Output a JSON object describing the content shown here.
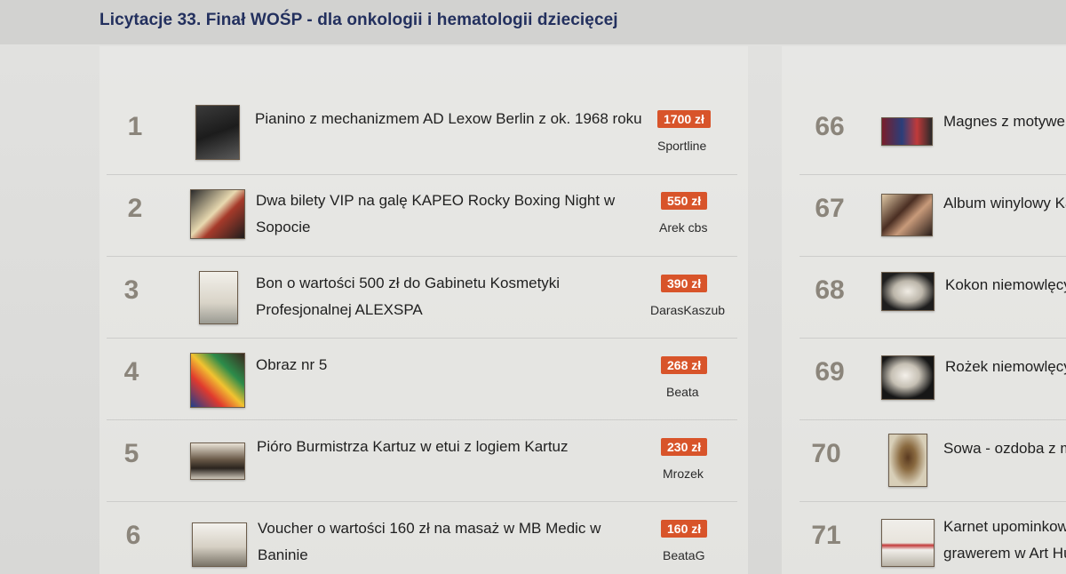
{
  "page_title": "Licytacje 33. Finał WOŚP - dla onkologii i hematologii dziecięcej",
  "left_items": [
    {
      "rank": "1",
      "title1": "Pianino z mechanizmem AD Lexow Berlin z ok. 1968 roku",
      "title2": "",
      "price": "1700 zł",
      "bidder": "Sportline"
    },
    {
      "rank": "2",
      "title1": "Dwa bilety VIP na galę KAPEO Rocky Boxing Night w",
      "title2": "Sopocie",
      "price": "550 zł",
      "bidder": "Arek cbs"
    },
    {
      "rank": "3",
      "title1": "Bon o wartości 500 zł do Gabinetu Kosmetyki",
      "title2": "Profesjonalnej ALEXSPA",
      "price": "390 zł",
      "bidder": "DarasKaszub"
    },
    {
      "rank": "4",
      "title1": "Obraz nr 5",
      "title2": "",
      "price": "268 zł",
      "bidder": "Beata"
    },
    {
      "rank": "5",
      "title1": "Pióro Burmistrza Kartuz w etui z logiem Kartuz",
      "title2": "",
      "price": "230 zł",
      "bidder": "Mrozek"
    },
    {
      "rank": "6",
      "title1": "Voucher o wartości 160 zł na masaż w MB Medic w",
      "title2": "Baninie",
      "price": "160 zł",
      "bidder": "BeataG"
    }
  ],
  "right_items": [
    {
      "rank": "66",
      "title1": "Magnes z motywer",
      "title2": ""
    },
    {
      "rank": "67",
      "title1": "Album winylowy Ka",
      "title2": ""
    },
    {
      "rank": "68",
      "title1": "Kokon niemowlęcy",
      "title2": ""
    },
    {
      "rank": "69",
      "title1": "Rożek niemowlęcy",
      "title2": ""
    },
    {
      "rank": "70",
      "title1": "Sowa - ozdoba z m",
      "title2": ""
    },
    {
      "rank": "71",
      "title1": "Karnet upominkowy",
      "title2": "grawerem w Art Hu"
    }
  ],
  "colors": {
    "title": "#23305e",
    "price_badge": "#d8542a",
    "rank": "#8b857b"
  }
}
